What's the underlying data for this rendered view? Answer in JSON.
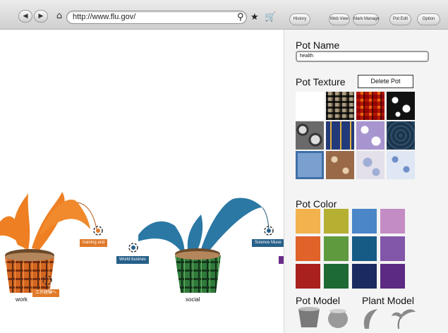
{
  "toolbar": {
    "url": "http://www.flu.gov/",
    "buttons": {
      "history": "History",
      "web_view": "Web View",
      "mark_manage": "Mark Manage",
      "pot_edit": "Pot Edit",
      "option": "Option"
    },
    "icons": [
      "back-icon",
      "forward-icon",
      "home-icon",
      "search-icon",
      "star-icon",
      "cart-icon"
    ]
  },
  "panel": {
    "pot_name_title": "Pot Name",
    "pot_name_value": "health",
    "pot_texture_title": "Pot Texture",
    "delete_button": "Delete Pot",
    "pot_color_title": "Pot Color",
    "pot_model_title": "Pot Model",
    "plant_model_title": "Plant Model",
    "colors": [
      "#f2b24e",
      "#b5b032",
      "#4a86c8",
      "#c48cc4",
      "#e0632a",
      "#5f9a3e",
      "#165a86",
      "#8256a8",
      "#a8211f",
      "#1d6a34",
      "#1c2a62",
      "#5c2a82"
    ]
  },
  "canvas": {
    "pots": [
      {
        "caption": "work",
        "tag": "工作経験へ"
      },
      {
        "caption": "social"
      }
    ],
    "labels": {
      "training": "training and",
      "world": "World busines",
      "science": "Science Muse"
    }
  }
}
